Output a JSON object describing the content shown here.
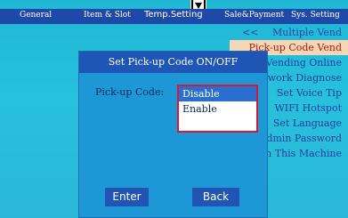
{
  "tabs": [
    {
      "label": "General",
      "active": false
    },
    {
      "label": "Item & Slot",
      "active": false
    },
    {
      "label": "Temp.Setting",
      "active": true
    },
    {
      "label": "Sale&Payment",
      "active": false
    },
    {
      "label": "Sys. Setting",
      "active": false
    }
  ],
  "menu": {
    "back_arrow": "<<",
    "items": [
      {
        "label": "Multiple Vend"
      },
      {
        "label": "Pick-up Code Vend",
        "selected": true
      },
      {
        "label": "Vending Online"
      },
      {
        "label": "Network Diagnose"
      },
      {
        "label": "Set Voice Tip"
      },
      {
        "label": "WIFI Hotspot"
      },
      {
        "label": "Set Language"
      },
      {
        "label": "Admin Password"
      },
      {
        "label": "Clean This Machine"
      }
    ]
  },
  "dialog": {
    "title": "Set Pick-up Code ON/OFF",
    "field_label": "Pick-up Code:",
    "options": [
      "Disable",
      "Enable"
    ],
    "selected_option": "Disable",
    "enter_label": "Enter",
    "back_label": "Back"
  },
  "colors": {
    "tab_bar": "#1f49a8",
    "menu_highlight_bg": "#f6d7b3",
    "menu_highlight_text": "#b51616",
    "dialog_bg": "#1d97d6",
    "dialog_title_bg": "#1f55b4",
    "dropdown_border": "#d61a32",
    "option_selected_bg": "#2a6fd0"
  }
}
